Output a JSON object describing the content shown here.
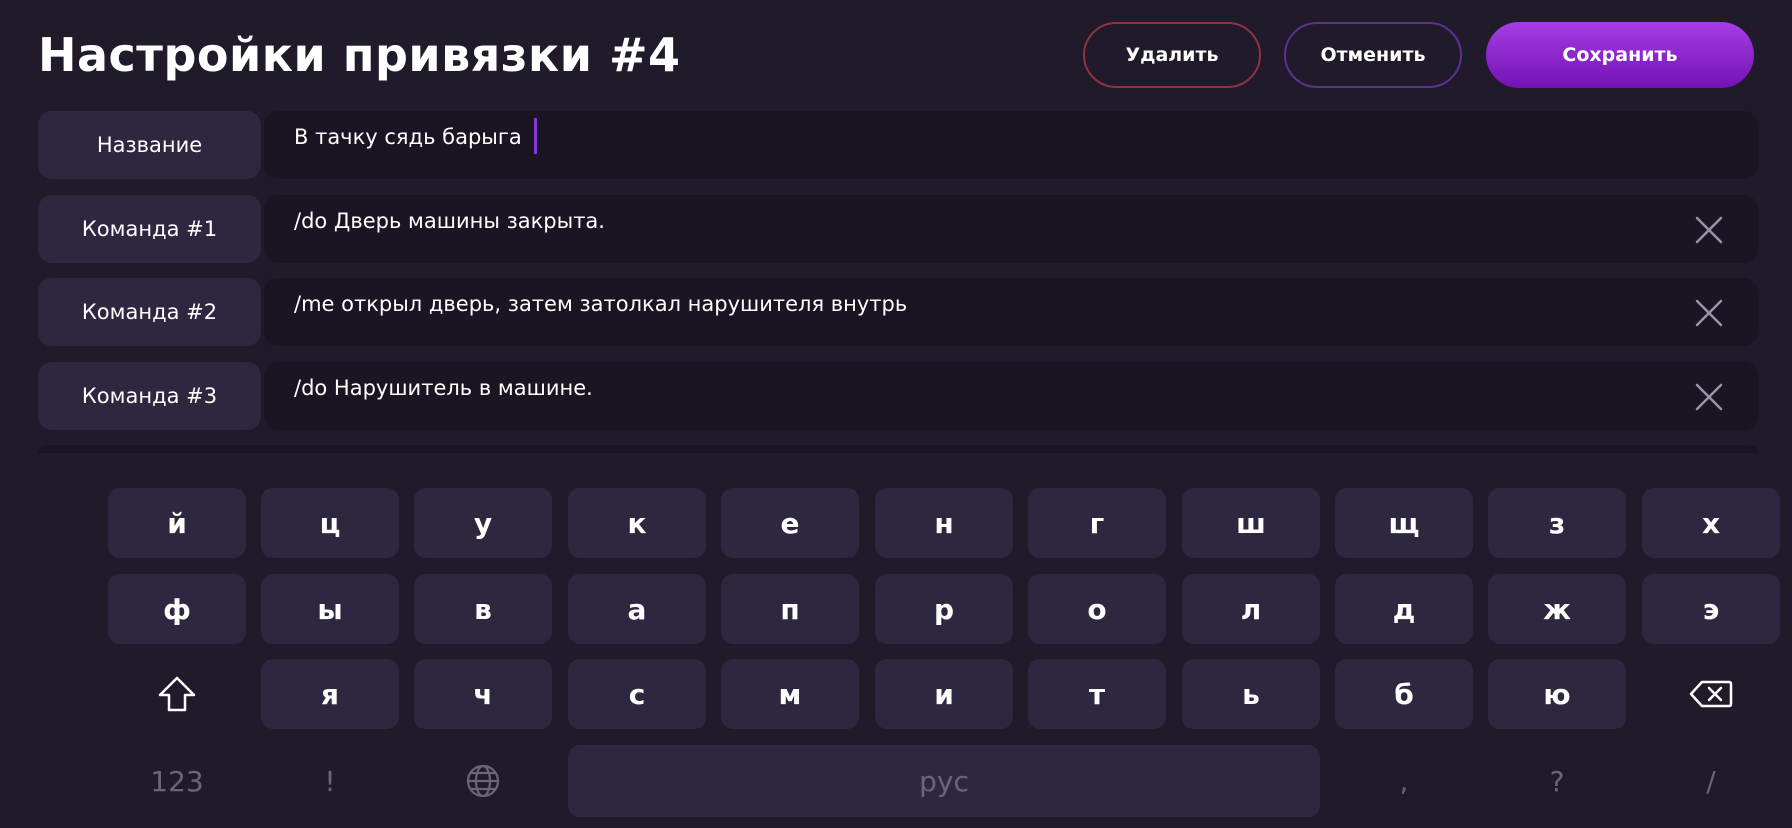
{
  "header": {
    "title": "Настройки привязки #4",
    "buttons": {
      "delete": "Удалить",
      "cancel": "Отменить",
      "save": "Сохранить"
    }
  },
  "rows": [
    {
      "label": "Название",
      "value": "В тачку сядь барыга",
      "has_close": false,
      "focused": true
    },
    {
      "label": "Команда #1",
      "value": "/do Дверь машины закрыта.",
      "has_close": true
    },
    {
      "label": "Команда #2",
      "value": "/me открыл дверь, затем затолкал нарушителя внутрь",
      "has_close": true
    },
    {
      "label": "Команда #3",
      "value": "/do Нарушитель в машине.",
      "has_close": true
    }
  ],
  "keyboard": {
    "row1": [
      "й",
      "ц",
      "у",
      "к",
      "е",
      "н",
      "г",
      "ш",
      "щ",
      "з",
      "х"
    ],
    "row2": [
      "ф",
      "ы",
      "в",
      "а",
      "п",
      "р",
      "о",
      "л",
      "д",
      "ж",
      "э"
    ],
    "row3": [
      "я",
      "ч",
      "с",
      "м",
      "и",
      "т",
      "ь",
      "б",
      "ю"
    ],
    "bottom": {
      "numbers": "123",
      "exclamation": "!",
      "space": "рус",
      "comma": ",",
      "question": "?",
      "slash": "/"
    },
    "icons": {
      "shift": "shift-icon",
      "backspace": "backspace-icon",
      "language": "globe-icon"
    }
  },
  "colors": {
    "background": "#211a2b",
    "label_bg": "#2f2740",
    "field_bg": "#1b1523",
    "accent": "#8a35e0",
    "delete_border": "#8f3340",
    "cancel_border": "#5c3194",
    "save_gradient_top": "#a53de4",
    "save_gradient_bottom": "#7312b4"
  }
}
